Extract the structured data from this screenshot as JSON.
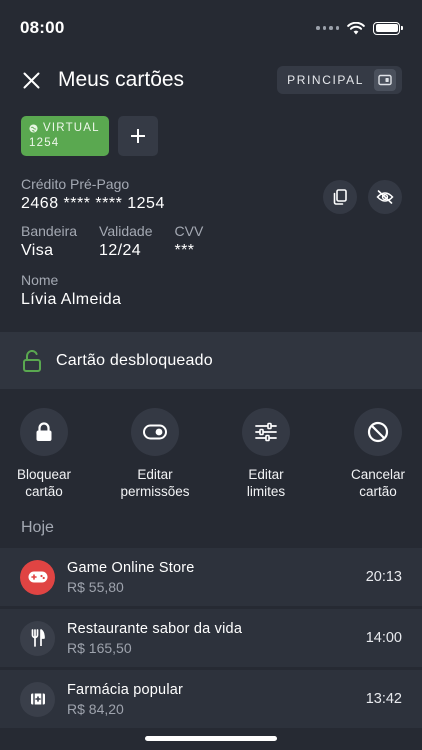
{
  "status_bar": {
    "time": "08:00"
  },
  "header": {
    "title": "Meus cartões",
    "principal_label": "PRINCIPAL"
  },
  "cards": {
    "selected": {
      "type_label": "VIRTUAL",
      "last_digits": "1254",
      "color": "#5aa850"
    }
  },
  "card_info": {
    "type_label": "Crédito Pré-Pago",
    "number": "2468 **** **** 1254",
    "brand_label": "Bandeira",
    "brand_value": "Visa",
    "validity_label": "Validade",
    "validity_value": "12/24",
    "cvv_label": "CVV",
    "cvv_value": "***",
    "name_label": "Nome",
    "name_value": "Lívia Almeida"
  },
  "status": {
    "text": "Cartão desbloqueado",
    "color": "#5aa850"
  },
  "actions": [
    {
      "label": "Bloquear\ncartão",
      "icon": "lock-icon"
    },
    {
      "label": "Editar\npermissões",
      "icon": "toggle-icon"
    },
    {
      "label": "Editar\nlimites",
      "icon": "sliders-icon"
    },
    {
      "label": "Cancelar\ncartão",
      "icon": "block-icon"
    }
  ],
  "transactions": {
    "section_label": "Hoje",
    "items": [
      {
        "name": "Game Online Store",
        "amount": "R$ 55,80",
        "time": "20:13",
        "icon": "gamepad-icon"
      },
      {
        "name": "Restaurante sabor da vida",
        "amount": "R$ 165,50",
        "time": "14:00",
        "icon": "cutlery-icon"
      },
      {
        "name": "Farmácia popular",
        "amount": "R$ 84,20",
        "time": "13:42",
        "icon": "first-aid-icon"
      }
    ]
  },
  "colors": {
    "background": "#262a33",
    "accent_green": "#5aa850",
    "accent_red": "#e04443"
  }
}
